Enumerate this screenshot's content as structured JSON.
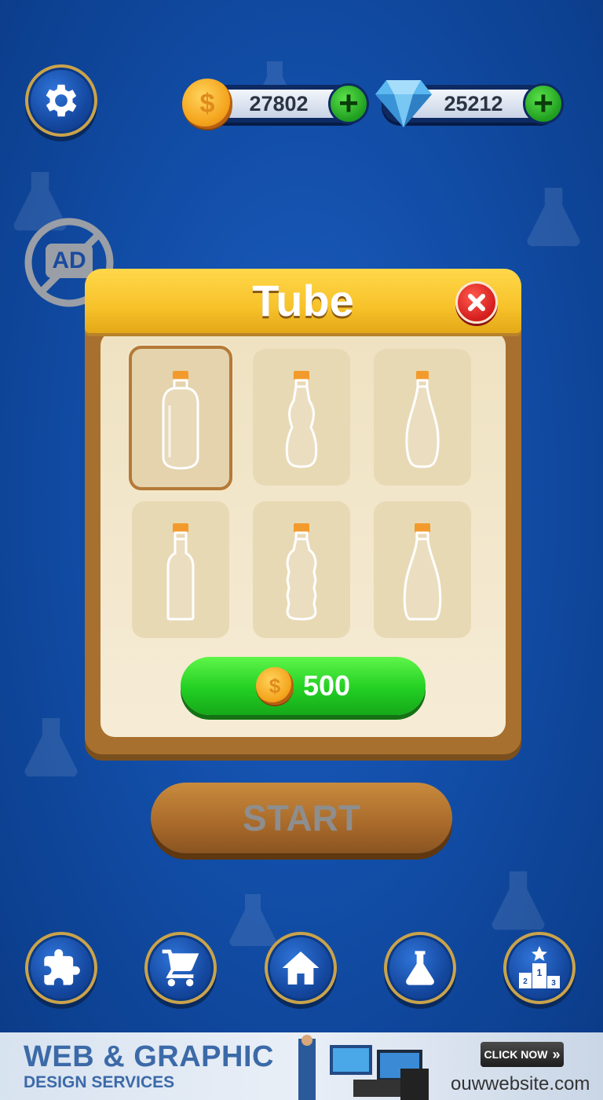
{
  "currency": {
    "coins": "27802",
    "gems": "25212",
    "coin_symbol": "$"
  },
  "panel": {
    "title": "Tube",
    "price": "500",
    "tubes": [
      {
        "shape": "capsule",
        "selected": true
      },
      {
        "shape": "cola",
        "selected": false
      },
      {
        "shape": "bowling-pin",
        "selected": false
      },
      {
        "shape": "wine",
        "selected": false
      },
      {
        "shape": "ribbed",
        "selected": false
      },
      {
        "shape": "teardrop",
        "selected": false
      }
    ]
  },
  "no_ads_label": "AD",
  "start_label": "START",
  "bottom_nav": [
    {
      "icon": "puzzle-icon"
    },
    {
      "icon": "cart-icon"
    },
    {
      "icon": "home-icon"
    },
    {
      "icon": "flask-icon"
    },
    {
      "icon": "podium-icon",
      "podium_labels": [
        "1",
        "2",
        "3"
      ]
    }
  ],
  "ad": {
    "title": "WEB & GRAPHIC",
    "subtitle": "DESIGN SERVICES",
    "cta": "CLICK NOW",
    "site": "ouwwebsite.com"
  },
  "colors": {
    "background": "#124ea8",
    "panel_header": "#f7c22a",
    "buy_button": "#22cf22",
    "start_button": "#a8692a",
    "close_button": "#d41d1d"
  }
}
